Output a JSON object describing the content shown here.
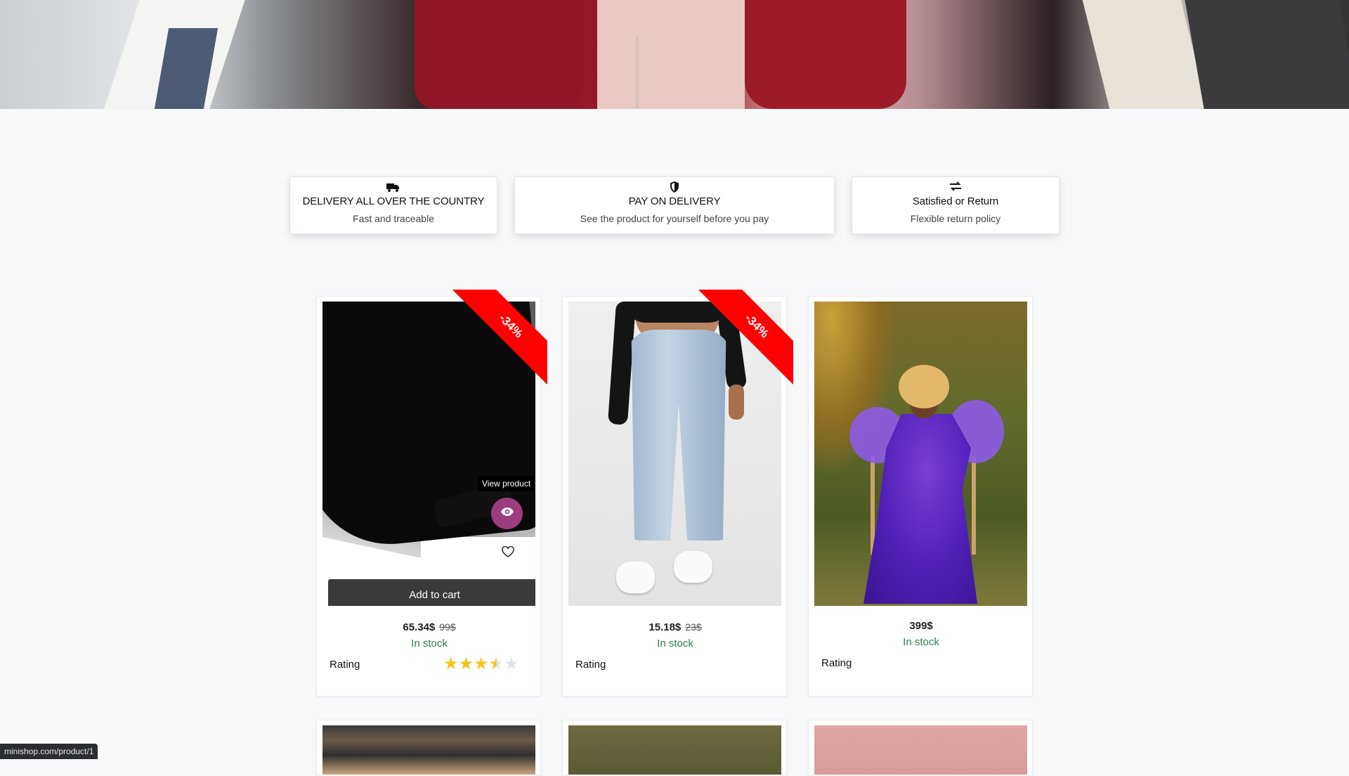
{
  "features": [
    {
      "icon": "delivery-truck-icon",
      "title": "DELIVERY ALL OVER THE COUNTRY",
      "subtitle": "Fast and traceable"
    },
    {
      "icon": "shield-icon",
      "title": "PAY ON DELIVERY",
      "subtitle": "See the product for yourself before you pay"
    },
    {
      "icon": "exchange-arrows-icon",
      "title": "Satisfied or Return",
      "subtitle": "Flexible return policy"
    }
  ],
  "products": [
    {
      "badge": "-34%",
      "price": "65.34$",
      "old_price": "99$",
      "stock": "In stock",
      "rating_label": "Rating",
      "rating": 3.5,
      "rating_max": 5,
      "tooltip": "View product",
      "add_to_cart": "Add to cart"
    },
    {
      "badge": "-34%",
      "price": "15.18$",
      "old_price": "23$",
      "stock": "In stock",
      "rating_label": "Rating"
    },
    {
      "price": "399$",
      "stock": "In stock",
      "rating_label": "Rating"
    }
  ],
  "status_url": "minishop.com/product/1",
  "colors": {
    "accent": "#9c3d7e",
    "badge": "#ff0000",
    "in_stock": "#2e7d4f",
    "button_dark": "#3a3a3a",
    "star": "#f5c518"
  }
}
